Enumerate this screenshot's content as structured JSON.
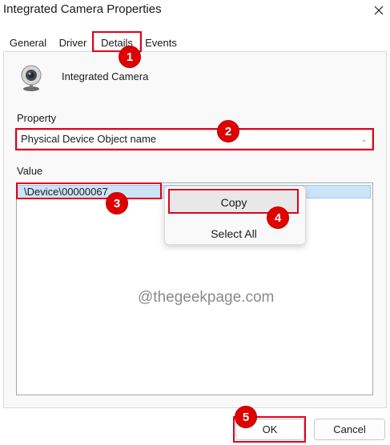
{
  "window": {
    "title": "Integrated Camera Properties"
  },
  "tabs": [
    {
      "label": "General"
    },
    {
      "label": "Driver"
    },
    {
      "label": "Details",
      "active": true
    },
    {
      "label": "Events"
    }
  ],
  "device": {
    "name": "Integrated Camera",
    "icon": "webcam-icon"
  },
  "property": {
    "label": "Property",
    "selected": "Physical Device Object name"
  },
  "value": {
    "label": "Value",
    "items": [
      "\\Device\\00000067"
    ]
  },
  "context_menu": {
    "items": [
      "Copy",
      "Select All"
    ]
  },
  "watermark": "@thegeekpage.com",
  "buttons": {
    "ok": "OK",
    "cancel": "Cancel"
  },
  "annotations": {
    "color": "#e3001b",
    "steps": [
      "1",
      "2",
      "3",
      "4",
      "5"
    ]
  }
}
